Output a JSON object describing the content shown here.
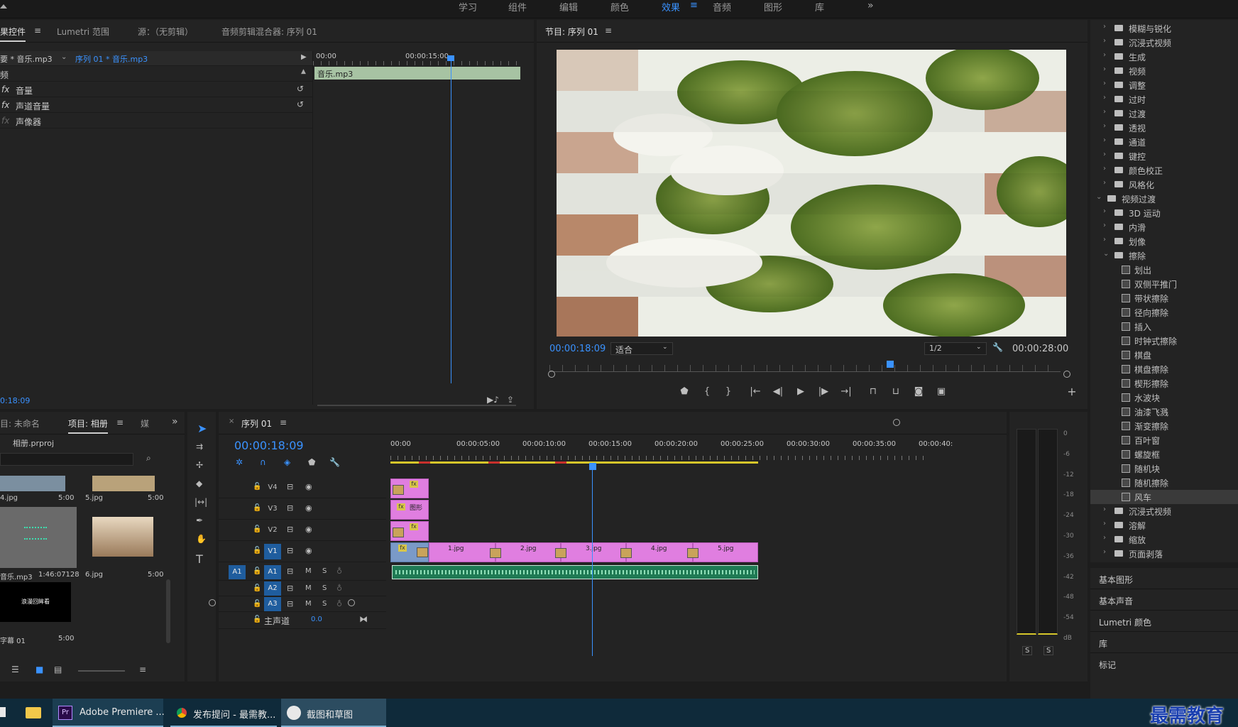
{
  "workspaces": [
    "学习",
    "组件",
    "编辑",
    "颜色",
    "效果",
    "音频",
    "图形",
    "库"
  ],
  "effect_controls": {
    "tabs": [
      "果控件",
      "Lumetri 范围",
      "源：（无剪辑）",
      "音频剪辑混合器: 序列 01"
    ],
    "source_label": "要 * 音乐.mp3",
    "seq_label": "序列 01 * 音乐.mp3",
    "section": "频",
    "items": [
      "音量",
      "声道音量",
      "声像器"
    ],
    "ruler": [
      "00:00",
      "00:00:15:00"
    ],
    "clip_name": "音乐.mp3",
    "timecode": "0:18:09"
  },
  "program": {
    "title": "节目: 序列 01",
    "timecode": "00:00:18:09",
    "fit": "适合",
    "resolution": "1/2",
    "duration": "00:00:28:00"
  },
  "effects_tree": [
    {
      "t": "folder",
      "label": "模糊与锐化"
    },
    {
      "t": "folder",
      "label": "沉浸式视频"
    },
    {
      "t": "folder",
      "label": "生成"
    },
    {
      "t": "folder",
      "label": "视频"
    },
    {
      "t": "folder",
      "label": "调整"
    },
    {
      "t": "folder",
      "label": "过时"
    },
    {
      "t": "folder",
      "label": "过渡"
    },
    {
      "t": "folder",
      "label": "透视"
    },
    {
      "t": "folder",
      "label": "通道"
    },
    {
      "t": "folder",
      "label": "键控"
    },
    {
      "t": "folder",
      "label": "颜色校正"
    },
    {
      "t": "folder",
      "label": "风格化"
    },
    {
      "t": "open",
      "label": "视频过渡"
    },
    {
      "t": "sub",
      "label": "3D 运动"
    },
    {
      "t": "sub",
      "label": "内滑"
    },
    {
      "t": "sub",
      "label": "划像"
    },
    {
      "t": "subopen",
      "label": "擦除"
    },
    {
      "t": "fx",
      "label": "划出"
    },
    {
      "t": "fx",
      "label": "双侧平推门"
    },
    {
      "t": "fx",
      "label": "带状擦除"
    },
    {
      "t": "fx",
      "label": "径向擦除"
    },
    {
      "t": "fx",
      "label": "插入"
    },
    {
      "t": "fx",
      "label": "时钟式擦除"
    },
    {
      "t": "fx",
      "label": "棋盘"
    },
    {
      "t": "fx",
      "label": "棋盘擦除"
    },
    {
      "t": "fx",
      "label": "楔形擦除"
    },
    {
      "t": "fx",
      "label": "水波块"
    },
    {
      "t": "fx",
      "label": "油漆飞溅"
    },
    {
      "t": "fx",
      "label": "渐变擦除"
    },
    {
      "t": "fx",
      "label": "百叶窗"
    },
    {
      "t": "fx",
      "label": "螺旋框"
    },
    {
      "t": "fx",
      "label": "随机块"
    },
    {
      "t": "fx",
      "label": "随机擦除"
    },
    {
      "t": "fxsel",
      "label": "风车"
    },
    {
      "t": "sub",
      "label": "沉浸式视频"
    },
    {
      "t": "sub",
      "label": "溶解"
    },
    {
      "t": "sub",
      "label": "缩放"
    },
    {
      "t": "sub",
      "label": "页面剥落"
    }
  ],
  "side_panels": [
    "基本图形",
    "基本声音",
    "Lumetri 颜色",
    "库",
    "标记"
  ],
  "project": {
    "tabs": [
      "目: 未命名",
      "项目: 相册",
      "媒"
    ],
    "file": "相册.prproj",
    "items": [
      {
        "name": "4.jpg",
        "dur": "5:00"
      },
      {
        "name": "5.jpg",
        "dur": "5:00"
      },
      {
        "name": "音乐.mp3",
        "dur": "1:46:07128"
      },
      {
        "name": "6.jpg",
        "dur": "5:00"
      },
      {
        "name": "字幕 01",
        "dur": "5:00"
      }
    ],
    "caption_thumb": "浪漫回眸看"
  },
  "timeline": {
    "tab": "序列 01",
    "timecode": "00:00:18:09",
    "ruler": [
      "00:00",
      "00:00:05:00",
      "00:00:10:00",
      "00:00:15:00",
      "00:00:20:00",
      "00:00:25:00",
      "00:00:30:00",
      "00:00:35:00",
      "00:00:40:"
    ],
    "tracks": [
      "V4",
      "V3",
      "V2",
      "V1",
      "A1",
      "A2",
      "A3"
    ],
    "master_label": "主声道",
    "master_val": "0.0",
    "src_a1": "A1",
    "v3_clip": "图形",
    "v1_clips": [
      "1.jpg",
      "2.jpg",
      "3.jpg",
      "4.jpg",
      "5.jpg"
    ],
    "m": "M",
    "s": "S"
  },
  "meter": {
    "scale": [
      "0",
      "-6",
      "-12",
      "-18",
      "-24",
      "-30",
      "-36",
      "-42",
      "-48",
      "-54",
      "dB"
    ],
    "solo": [
      "S",
      "S"
    ]
  },
  "taskbar": {
    "apps": [
      "Adobe Premiere ...",
      "发布提问 - 最需教...",
      "截图和草图"
    ],
    "watermark": "最需教育"
  }
}
